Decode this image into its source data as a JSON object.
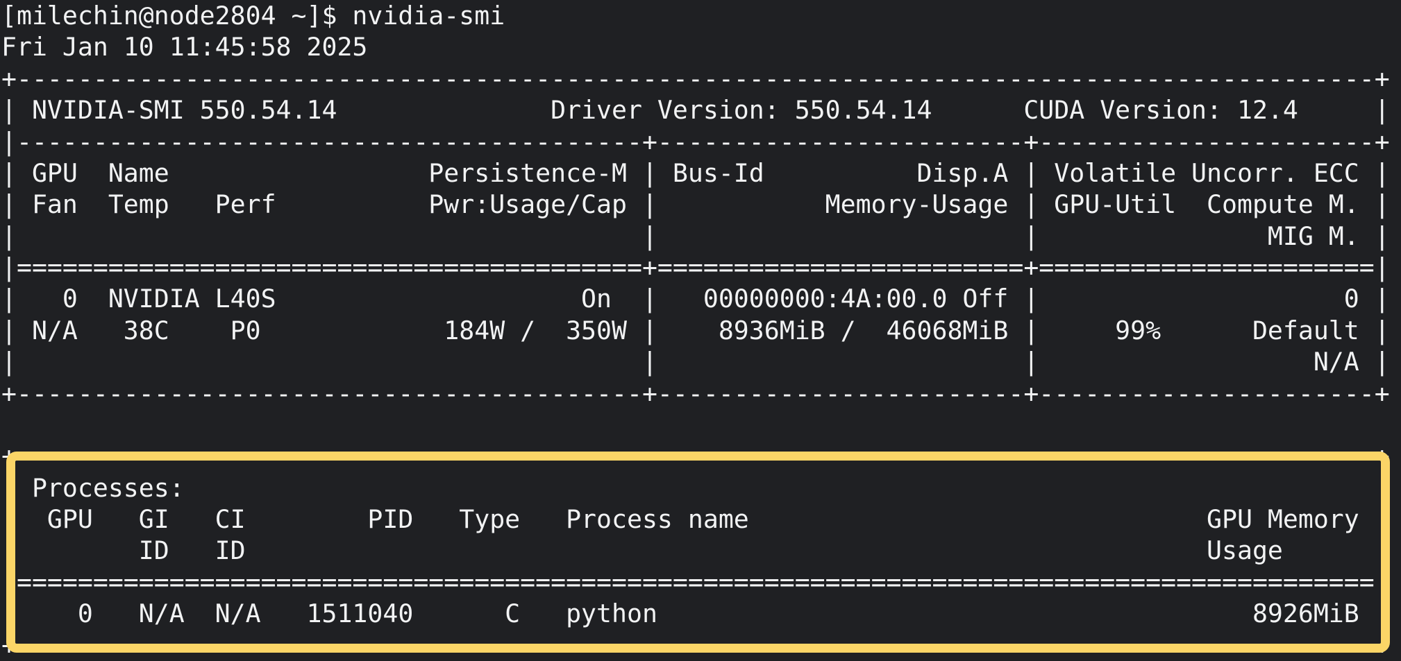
{
  "shell": {
    "prompt": "[milechin@node2804 ~]$",
    "command": "nvidia-smi",
    "timestamp": "Fri Jan 10 11:45:58 2025"
  },
  "system_monitor": {
    "tool": "nvidia-smi",
    "nvidia_smi_version": "550.54.14",
    "driver_version": "550.54.14",
    "cuda_version": "12.4",
    "gpu_table_headers_row1": [
      "GPU",
      "Name",
      "Persistence-M",
      "Bus-Id",
      "Disp.A",
      "Volatile Uncorr. ECC"
    ],
    "gpu_table_headers_row2": [
      "Fan",
      "Temp",
      "Perf",
      "Pwr:Usage/Cap",
      "Memory-Usage",
      "GPU-Util",
      "Compute M."
    ],
    "gpu_table_headers_row3": [
      "MIG M."
    ],
    "gpus": [
      {
        "index": "0",
        "name": "NVIDIA L40S",
        "persistence_m": "On",
        "fan": "N/A",
        "temp": "38C",
        "perf": "P0",
        "pwr_usage_cap": "184W /  350W",
        "bus_id": "00000000:4A:00.0",
        "disp_a": "Off",
        "memory_usage": "8936MiB /  46068MiB",
        "gpu_util": "99%",
        "compute_m": "Default",
        "uncorr_ecc": "0",
        "mig_m": "N/A"
      }
    ],
    "process_table_title": "Processes:",
    "process_table_headers": [
      "GPU",
      "GI ID",
      "CI ID",
      "PID",
      "Type",
      "Process name",
      "GPU Memory Usage"
    ],
    "processes": [
      {
        "gpu": "0",
        "gi_id": "N/A",
        "ci_id": "N/A",
        "pid": "1511040",
        "type": "C",
        "process_name": "python",
        "gpu_memory_usage": "8926MiB"
      }
    ]
  },
  "annotation": {
    "type": "highlight-box",
    "target": "processes-table",
    "color": "#fbd567"
  },
  "colors": {
    "background": "#1f2023",
    "text": "#f2f3f4",
    "highlight": "#fbd567"
  },
  "terminal": {
    "lines": [
      "[milechin@node2804 ~]$ nvidia-smi",
      "Fri Jan 10 11:45:58 2025",
      "+-----------------------------------------------------------------------------------------+",
      "| NVIDIA-SMI 550.54.14              Driver Version: 550.54.14      CUDA Version: 12.4     |",
      "|-----------------------------------------+------------------------+----------------------+",
      "| GPU  Name                 Persistence-M | Bus-Id          Disp.A | Volatile Uncorr. ECC |",
      "| Fan  Temp   Perf          Pwr:Usage/Cap |           Memory-Usage | GPU-Util  Compute M. |",
      "|                                         |                        |               MIG M. |",
      "|=========================================+========================+======================|",
      "|   0  NVIDIA L40S                    On  |   00000000:4A:00.0 Off |                    0 |",
      "| N/A   38C    P0            184W /  350W |    8936MiB /  46068MiB |     99%      Default |",
      "|                                         |                        |                  N/A |",
      "+-----------------------------------------+------------------------+----------------------+",
      "",
      "+-----------------------------------------------------------------------------------------+",
      "| Processes:                                                                              |",
      "|  GPU   GI   CI        PID   Type   Process name                              GPU Memory |",
      "|        ID   ID                                                               Usage      |",
      "|=========================================================================================|",
      "|    0   N/A  N/A   1511040      C   python                                       8926MiB |",
      "+-----------------------------------------------------------------------------------------+"
    ]
  }
}
